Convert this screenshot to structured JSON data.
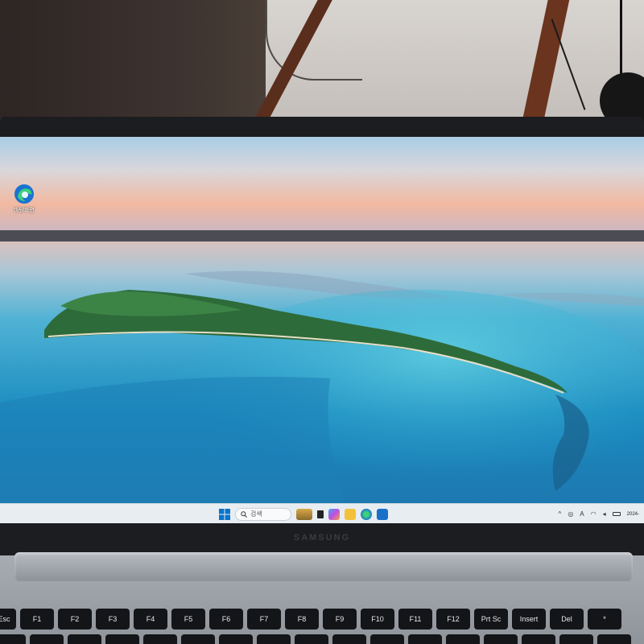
{
  "desktop": {
    "icon_label": "바탕화면",
    "icon_name": "edge-icon"
  },
  "taskbar": {
    "search_placeholder": "검색",
    "icons": [
      "windows-start-icon",
      "search-icon",
      "widgets-icon",
      "task-view-icon",
      "copilot-icon",
      "file-explorer-icon",
      "edge-icon",
      "store-icon"
    ],
    "tray_lang": "A",
    "clock_time": "",
    "clock_date": "2024-"
  },
  "brand": {
    "logo": "SAMSUNG"
  },
  "keyboard": {
    "row_fn": [
      "Esc",
      "F1",
      "F2",
      "F3",
      "F4",
      "F5",
      "F6",
      "F7",
      "F8",
      "F9",
      "F10",
      "F11",
      "F12",
      "Prt Sc",
      "Insert",
      "Del",
      "*"
    ],
    "row_fn_sub": [
      "",
      "",
      "",
      "",
      "",
      "",
      "",
      "",
      "",
      "",
      "",
      "",
      "",
      "",
      "",
      "",
      ""
    ]
  },
  "colors": {
    "accent_blue": "#0a74c9",
    "water": "#1e8fbf",
    "sky_pink": "#f1b89e",
    "taskbar": "#e8edf2"
  }
}
